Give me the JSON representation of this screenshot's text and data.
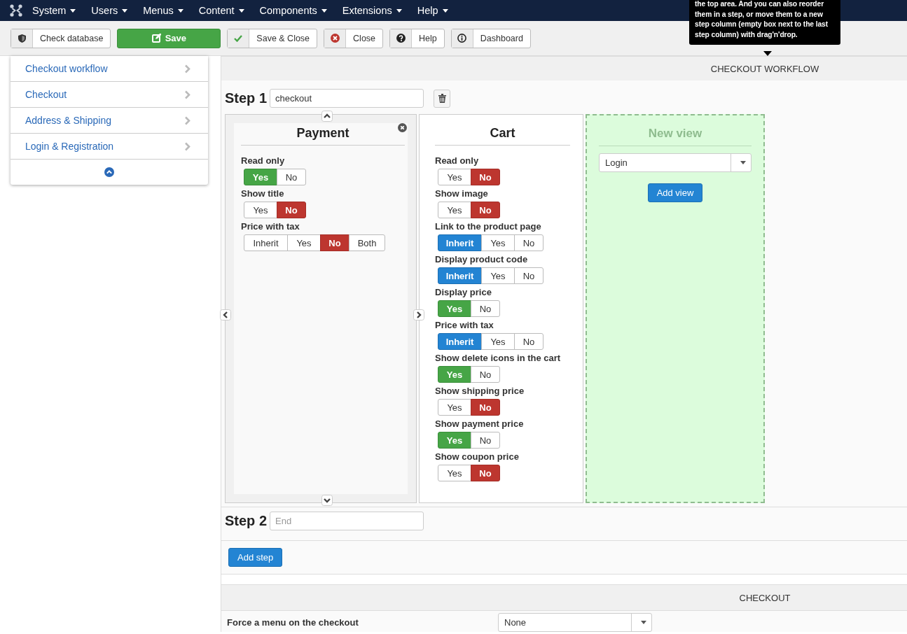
{
  "nav_menu": [
    {
      "label": "System"
    },
    {
      "label": "Users"
    },
    {
      "label": "Menus"
    },
    {
      "label": "Content"
    },
    {
      "label": "Components"
    },
    {
      "label": "Extensions"
    },
    {
      "label": "Help"
    }
  ],
  "toolbar": [
    {
      "label": "Check database",
      "kind": "shield"
    },
    {
      "label": "Save",
      "kind": "primary"
    },
    {
      "label": "Save & Close",
      "kind": "check"
    },
    {
      "label": "Close",
      "kind": "close"
    },
    {
      "label": "Help",
      "kind": "help"
    },
    {
      "label": "Dashboard",
      "kind": "dashboard"
    }
  ],
  "tooltip": "the top area. And you can also reorder them in a step, or move them to a new step column (empty box next to the last step column) with drag'n'drop.",
  "sidebar": {
    "items": [
      {
        "label": "Checkout workflow"
      },
      {
        "label": "Checkout"
      },
      {
        "label": "Address & Shipping"
      },
      {
        "label": "Login & Registration"
      }
    ]
  },
  "workflow": {
    "title": "CHECKOUT WORKFLOW",
    "step1": {
      "label": "Step 1",
      "value": "checkout",
      "views": [
        {
          "title": "Payment",
          "hovered": true,
          "options": [
            {
              "label": "Read only",
              "choices": [
                {
                  "label": "Yes",
                  "kind": "yes",
                  "selected": true
                },
                {
                  "label": "No",
                  "kind": "no",
                  "selected": false
                }
              ]
            },
            {
              "label": "Show title",
              "choices": [
                {
                  "label": "Yes",
                  "kind": "yes",
                  "selected": false
                },
                {
                  "label": "No",
                  "kind": "no",
                  "selected": true
                }
              ]
            },
            {
              "label": "Price with tax",
              "choices": [
                {
                  "label": "Inherit",
                  "kind": "inherit",
                  "selected": false
                },
                {
                  "label": "Yes",
                  "kind": "yes",
                  "selected": false
                },
                {
                  "label": "No",
                  "kind": "no",
                  "selected": true
                },
                {
                  "label": "Both",
                  "kind": "both",
                  "selected": false
                }
              ]
            }
          ]
        },
        {
          "title": "Cart",
          "hovered": false,
          "options": [
            {
              "label": "Read only",
              "choices": [
                {
                  "label": "Yes",
                  "kind": "yes",
                  "selected": false
                },
                {
                  "label": "No",
                  "kind": "no",
                  "selected": true
                }
              ]
            },
            {
              "label": "Show image",
              "choices": [
                {
                  "label": "Yes",
                  "kind": "yes",
                  "selected": false
                },
                {
                  "label": "No",
                  "kind": "no",
                  "selected": true
                }
              ]
            },
            {
              "label": "Link to the product page",
              "choices": [
                {
                  "label": "Inherit",
                  "kind": "inherit",
                  "selected": true
                },
                {
                  "label": "Yes",
                  "kind": "yes",
                  "selected": false
                },
                {
                  "label": "No",
                  "kind": "no",
                  "selected": false
                }
              ]
            },
            {
              "label": "Display product code",
              "choices": [
                {
                  "label": "Inherit",
                  "kind": "inherit",
                  "selected": true
                },
                {
                  "label": "Yes",
                  "kind": "yes",
                  "selected": false
                },
                {
                  "label": "No",
                  "kind": "no",
                  "selected": false
                }
              ]
            },
            {
              "label": "Display price",
              "choices": [
                {
                  "label": "Yes",
                  "kind": "yes",
                  "selected": true
                },
                {
                  "label": "No",
                  "kind": "no",
                  "selected": false
                }
              ]
            },
            {
              "label": "Price with tax",
              "choices": [
                {
                  "label": "Inherit",
                  "kind": "inherit",
                  "selected": true
                },
                {
                  "label": "Yes",
                  "kind": "yes",
                  "selected": false
                },
                {
                  "label": "No",
                  "kind": "no",
                  "selected": false
                }
              ]
            },
            {
              "label": "Show delete icons in the cart",
              "choices": [
                {
                  "label": "Yes",
                  "kind": "yes",
                  "selected": true
                },
                {
                  "label": "No",
                  "kind": "no",
                  "selected": false
                }
              ]
            },
            {
              "label": "Show shipping price",
              "choices": [
                {
                  "label": "Yes",
                  "kind": "yes",
                  "selected": false
                },
                {
                  "label": "No",
                  "kind": "no",
                  "selected": true
                }
              ]
            },
            {
              "label": "Show payment price",
              "choices": [
                {
                  "label": "Yes",
                  "kind": "yes",
                  "selected": true
                },
                {
                  "label": "No",
                  "kind": "no",
                  "selected": false
                }
              ]
            },
            {
              "label": "Show coupon price",
              "choices": [
                {
                  "label": "Yes",
                  "kind": "yes",
                  "selected": false
                },
                {
                  "label": "No",
                  "kind": "no",
                  "selected": true
                }
              ]
            }
          ]
        }
      ],
      "new_view": {
        "title": "New view",
        "value": "Login",
        "button": "Add view"
      }
    },
    "step2": {
      "label": "Step 2",
      "placeholder": "End"
    },
    "add_step": "Add step"
  },
  "checkout": {
    "title": "CHECKOUT",
    "fields": [
      {
        "label": "Force a menu on the checkout",
        "value": "None"
      }
    ]
  }
}
